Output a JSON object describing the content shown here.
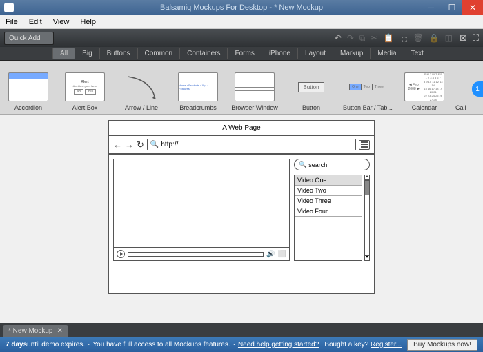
{
  "window": {
    "title": "Balsamiq Mockups For Desktop - * New Mockup"
  },
  "menu": [
    "File",
    "Edit",
    "View",
    "Help"
  ],
  "toolbar": {
    "quick_add": "Quick Add"
  },
  "categories": [
    "All",
    "Big",
    "Buttons",
    "Common",
    "Containers",
    "Forms",
    "iPhone",
    "Layout",
    "Markup",
    "Media",
    "Text"
  ],
  "library": {
    "items": [
      {
        "label": "Accordion"
      },
      {
        "label": "Alert Box"
      },
      {
        "label": "Arrow / Line"
      },
      {
        "label": "Breadcrumbs"
      },
      {
        "label": "Browser Window"
      },
      {
        "label": "Button"
      },
      {
        "label": "Button Bar / Tab..."
      },
      {
        "label": "Calendar"
      },
      {
        "label": "Call"
      }
    ],
    "badge": "1"
  },
  "alert_thumb": {
    "title": "Alert",
    "text": "Alert text goes here",
    "no": "No",
    "yes": "Yes"
  },
  "button_thumb": "Button",
  "buttonbar_thumb": {
    "one": "One",
    "two": "Two",
    "three": "Three"
  },
  "calendar_thumb": {
    "header": "◀ Feb 2008 ▶"
  },
  "mockup": {
    "title": "A Web Page",
    "url": "http://",
    "search_placeholder": "search",
    "videos": [
      "Video One",
      "Video Two",
      "Video Three",
      "Video Four"
    ]
  },
  "doc_tab": "* New Mockup",
  "status": {
    "days": "7 days",
    "expires": " until demo expires.",
    "full_access": "You have full access to all Mockups features.",
    "help_link": "Need help getting started?",
    "bought": "Bought a key? ",
    "register": "Register...",
    "buy": "Buy Mockups now!"
  }
}
